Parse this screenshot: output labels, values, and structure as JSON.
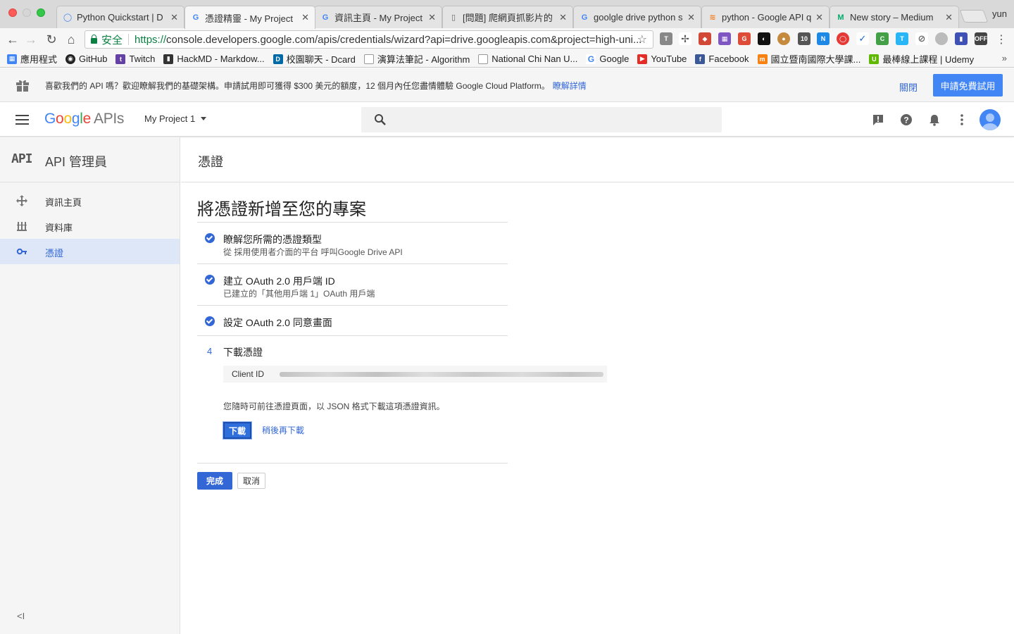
{
  "browser": {
    "tabs": [
      {
        "label": "Python Quickstart  |  D",
        "favicon": "python-favicon",
        "color": "#4285f4"
      },
      {
        "label": "憑證精靈 - My Project",
        "favicon": "google-favicon",
        "color": "#4285f4",
        "active": true
      },
      {
        "label": "資訊主頁 - My Project",
        "favicon": "google-favicon",
        "color": "#4285f4"
      },
      {
        "label": "[問題] 爬網頁抓影片的",
        "favicon": "document-favicon",
        "color": "#666666"
      },
      {
        "label": "goolgle drive python s",
        "favicon": "google-favicon",
        "color": "#4285f4"
      },
      {
        "label": "python - Google API q",
        "favicon": "stackoverflow-favicon",
        "color": "#f48024"
      },
      {
        "label": "New story – Medium",
        "favicon": "medium-favicon",
        "color": "#00ab6c"
      }
    ],
    "user": "yun",
    "security_label": "安全",
    "url_scheme": "https://",
    "url_rest": "console.developers.google.com/apis/credentials/wizard?api=drive.googleapis.com&project=high-uni...",
    "bookmarks": [
      {
        "label": "應用程式",
        "icon": "apps-icon",
        "color": "#4285f4"
      },
      {
        "label": "GitHub",
        "icon": "github-icon",
        "color": "#222222"
      },
      {
        "label": "Twitch",
        "icon": "twitch-icon",
        "color": "#6441a5"
      },
      {
        "label": "HackMD - Markdow...",
        "icon": "hackmd-icon",
        "color": "#333333"
      },
      {
        "label": "校園聊天 - Dcard",
        "icon": "dcard-icon",
        "color": "#006aa6"
      },
      {
        "label": "演算法筆記 - Algorithm",
        "icon": "page-icon",
        "color": "#888888"
      },
      {
        "label": "National Chi Nan U...",
        "icon": "page-icon",
        "color": "#888888"
      },
      {
        "label": "Google",
        "icon": "google-icon",
        "color": "#4285f4"
      },
      {
        "label": "YouTube",
        "icon": "youtube-icon",
        "color": "#e52d27"
      },
      {
        "label": "Facebook",
        "icon": "facebook-icon",
        "color": "#3b5998"
      },
      {
        "label": "國立暨南國際大學課...",
        "icon": "moodle-icon",
        "color": "#f98012"
      },
      {
        "label": "最棒線上課程 | Udemy",
        "icon": "udemy-icon",
        "color": "#5fb900"
      }
    ]
  },
  "promo": {
    "text": "喜歡我們的 API 嗎？歡迎瞭解我們的基礎架構。申請試用即可獲得 $300 美元的額度，12 個月內任您盡情體驗 Google Cloud Platform。",
    "link": "瞭解詳情",
    "close": "關閉",
    "cta": "申請免費試用"
  },
  "appbar": {
    "logo_google": "Google",
    "logo_apis": "APIs",
    "project": "My Project 1"
  },
  "sidebar": {
    "api_mark": "API",
    "title": "API 管理員",
    "items": [
      {
        "label": "資訊主頁",
        "icon": "dashboard-icon"
      },
      {
        "label": "資料庫",
        "icon": "library-icon"
      },
      {
        "label": "憑證",
        "icon": "key-icon",
        "active": true
      }
    ],
    "collapse": "<I"
  },
  "main": {
    "page_title": "憑證",
    "wizard_title": "將憑證新增至您的專案",
    "steps": [
      {
        "title": "瞭解您所需的憑證類型",
        "sub": "從 採用使用者介面的平台 呼叫Google Drive API"
      },
      {
        "title": "建立 OAuth 2.0 用戶端 ID",
        "sub": "已建立的「其他用戶端 1」OAuth 用戶端"
      },
      {
        "title": "設定 OAuth 2.0 同意畫面",
        "sub": ""
      },
      {
        "number": "4",
        "title": "下載憑證"
      }
    ],
    "client_id_label": "Client ID",
    "download_note": "您隨時可前往憑證頁面，以 JSON 格式下載這項憑證資訊。",
    "download_button": "下載",
    "download_later": "稍後再下載",
    "done_button": "完成",
    "cancel_button": "取消"
  },
  "colors": {
    "accent": "#3367d6",
    "google_blue": "#4285f4"
  }
}
